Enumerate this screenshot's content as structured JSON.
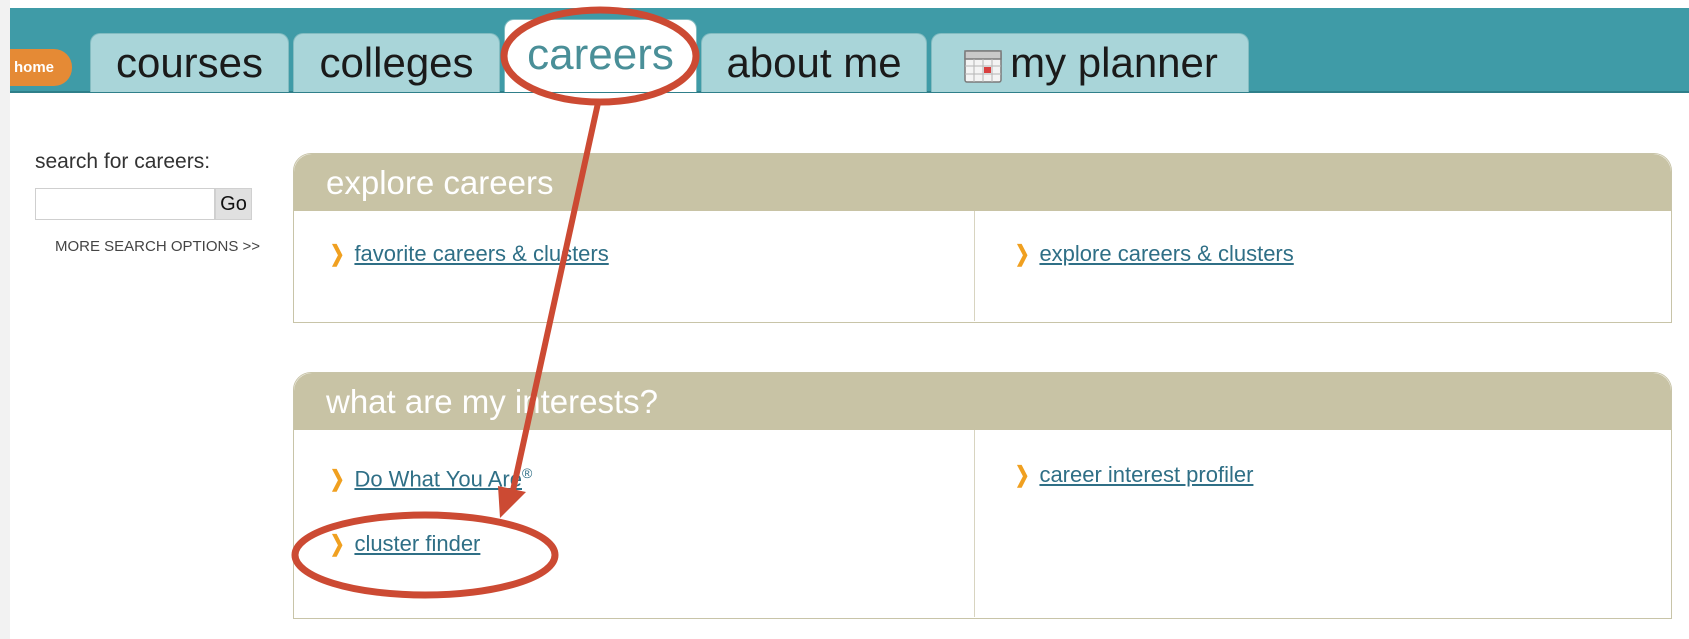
{
  "nav": {
    "home_label": "home",
    "tabs": [
      {
        "label": "courses"
      },
      {
        "label": "colleges"
      },
      {
        "label": "careers"
      },
      {
        "label": "about me"
      },
      {
        "label": "my planner"
      }
    ]
  },
  "search": {
    "label": "search for careers:",
    "input_value": "",
    "go_label": "Go",
    "more_options": "MORE SEARCH OPTIONS >>"
  },
  "explore": {
    "title": "explore careers",
    "links": [
      "favorite careers & clusters",
      "explore careers & clusters"
    ]
  },
  "interests": {
    "title": "what are my interests?",
    "links": [
      "Do What You Are",
      "cluster finder",
      "career interest profiler"
    ],
    "trademark": "®"
  },
  "colors": {
    "topbar": "#3f9ba7",
    "tab": "#a9d5d9",
    "home": "#e58a35",
    "panel_header": "#c8c3a5",
    "link": "#2f6f86",
    "annotation": "#cc4a33"
  },
  "icons": {
    "planner": "calendar-icon",
    "bullet": "chevron-right-icon"
  }
}
